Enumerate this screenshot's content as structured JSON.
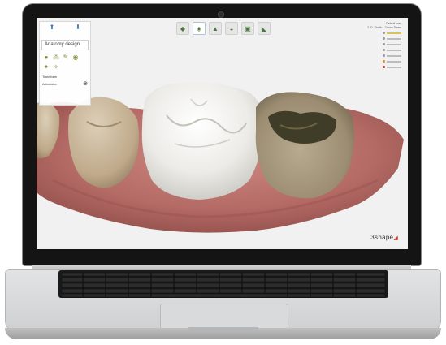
{
  "app": {
    "brand": "3shape",
    "logo_mark": "◢"
  },
  "toolbar": {
    "icons": [
      "tooth-icon",
      "crown-icon",
      "bridge-icon",
      "arch-icon",
      "model-icon",
      "scanner-icon"
    ]
  },
  "left_panel": {
    "top_left_label": "",
    "top_right_label": "",
    "title": "Anatomy design",
    "tool_icons": [
      "tooth-tool-icon",
      "tooth-group-icon",
      "sculpt-icon",
      "smooth-icon",
      "contact-icon",
      "morph-icon"
    ],
    "transform_label": "Transform",
    "articulator_label": "Articulator",
    "bottom_left": "",
    "bottom_right": ""
  },
  "right_panel": {
    "line1": "Default user",
    "line2": "7. D. Studio - Crown Demo"
  },
  "colors": {
    "gum": "#b76a66",
    "tooth_crown": "#ededea",
    "tooth_natural": "#c8b59a",
    "accent": "#3a7bbf",
    "logo_red": "#d23b2f"
  }
}
